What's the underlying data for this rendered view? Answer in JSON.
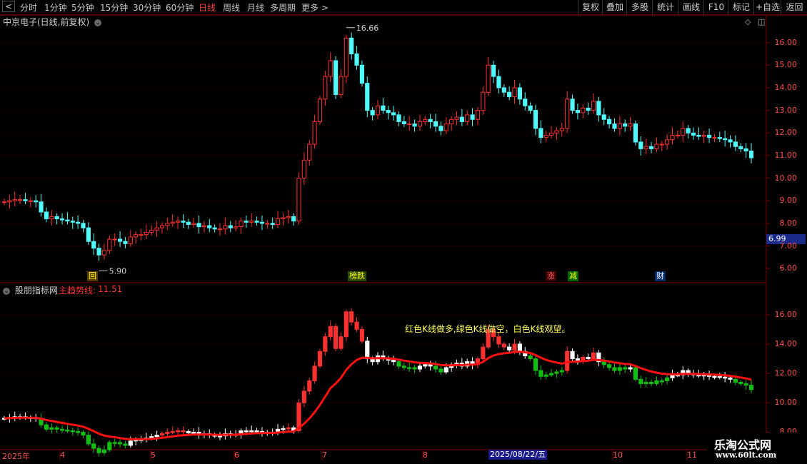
{
  "topbar": {
    "periods": [
      "分时",
      "1分钟",
      "5分钟",
      "15分钟",
      "30分钟",
      "60分钟",
      "日线",
      "周线",
      "月线",
      "多周期",
      "更多 >"
    ],
    "active": "日线",
    "tools": [
      "复权",
      "叠加",
      "多股",
      "统计",
      "画线",
      "F10",
      "标记",
      "+自选",
      "返回"
    ]
  },
  "stock": {
    "title": "中京电子(日线,前复权)"
  },
  "indicator": {
    "title": "股朋指标网",
    "main_label": "主趋势线:",
    "main_value": "11.51"
  },
  "price_box": "6.99",
  "note": "红色K线做多,绿色K线做空，白色K线观望。",
  "annotations": {
    "high": "16.66",
    "low": "5.90"
  },
  "tags": [
    {
      "text": "回",
      "color": "#ffff00",
      "bg": "#5a3a00"
    },
    {
      "text": "榜跌",
      "color": "#ffff00",
      "bg": "#2a4a00"
    },
    {
      "text": "涨",
      "color": "#ff6060",
      "bg": "#3a0000"
    },
    {
      "text": "减",
      "color": "#ffff00",
      "bg": "#006600"
    },
    {
      "text": "财",
      "color": "#ffffff",
      "bg": "#002a6a"
    }
  ],
  "upper_axis": [
    "16.00",
    "15.00",
    "14.00",
    "13.00",
    "12.00",
    "11.00",
    "10.00",
    "9.00",
    "8.00",
    "7.00",
    "6.00"
  ],
  "lower_axis": [
    "16.00",
    "14.00",
    "12.00",
    "10.00",
    "8.00"
  ],
  "dates": [
    "2025年",
    "4",
    "5",
    "6",
    "7",
    "8",
    "10",
    "11"
  ],
  "date_highlight": "2025/08/22/五",
  "watermark": {
    "line1": "乐淘公式网",
    "line2": "www.60lt.com"
  },
  "colors": {
    "up": "#ff3030",
    "down": "#50ffff",
    "trend": "#ff1010",
    "bear": "#10c010",
    "neutral": "#ffffff",
    "grid": "#5a0000"
  },
  "chart_data": {
    "type": "candlestick",
    "price_range": [
      5.5,
      17.0
    ],
    "indicator_range": [
      7.0,
      17.5
    ],
    "closes": [
      8.95,
      9.0,
      9.05,
      9.05,
      9.0,
      9.0,
      8.95,
      8.5,
      8.2,
      8.3,
      8.2,
      8.15,
      8.1,
      8.05,
      8.0,
      7.8,
      7.2,
      6.9,
      6.6,
      6.8,
      7.3,
      7.3,
      7.2,
      7.1,
      7.4,
      7.5,
      7.5,
      7.6,
      7.7,
      7.8,
      7.9,
      8.0,
      8.05,
      8.1,
      8.05,
      7.95,
      8.0,
      7.85,
      7.9,
      7.8,
      7.75,
      7.75,
      7.9,
      7.8,
      7.85,
      8.1,
      8.05,
      8.1,
      8.05,
      8.0,
      8.0,
      7.95,
      8.2,
      8.25,
      8.3,
      8.1,
      10.0,
      10.8,
      11.5,
      12.5,
      13.5,
      14.5,
      15.2,
      13.7,
      14.5,
      16.2,
      15.5,
      15.0,
      14.2,
      13.0,
      12.8,
      13.2,
      13.0,
      12.9,
      12.8,
      12.5,
      12.4,
      12.4,
      12.3,
      12.5,
      12.6,
      12.5,
      12.3,
      12.1,
      12.4,
      12.6,
      12.7,
      12.5,
      12.8,
      12.6,
      13.0,
      13.8,
      15.0,
      14.5,
      14.0,
      13.8,
      13.6,
      14.0,
      13.5,
      13.2,
      13.0,
      12.2,
      11.8,
      11.9,
      12.0,
      12.1,
      12.2,
      13.5,
      13.0,
      12.9,
      13.1,
      13.0,
      13.4,
      12.8,
      12.6,
      12.4,
      12.2,
      12.4,
      12.3,
      12.4,
      11.6,
      11.3,
      11.4,
      11.3,
      11.5,
      11.5,
      11.7,
      11.9,
      11.9,
      12.2,
      12.0,
      11.9,
      11.85,
      11.9,
      11.8,
      11.8,
      11.75,
      11.7,
      11.6,
      11.4,
      11.3,
      11.2,
      10.9
    ]
  }
}
